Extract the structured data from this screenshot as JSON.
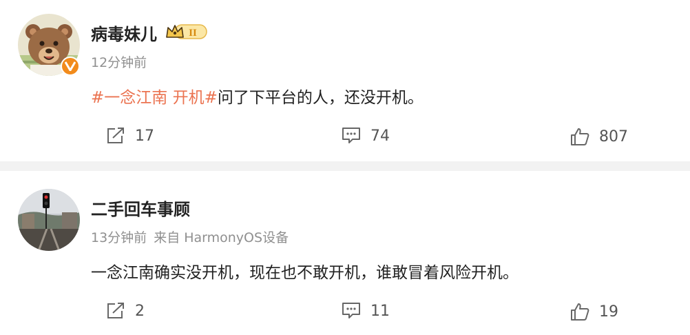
{
  "posts": [
    {
      "user": "病毒妹儿",
      "time": "12分钟前",
      "source": "",
      "topic": "#一念江南 开机#",
      "text": "问了下平台的人，还没开机。",
      "shares": "17",
      "comments": "74",
      "likes": "807",
      "badge_icon": "level-II-crown-badge-icon",
      "verified_icon": "orange-v-verified-icon"
    },
    {
      "user": "二手回车事顾",
      "time": "13分钟前",
      "source": "来自 HarmonyOS设备",
      "text": "一念江南确实没开机，现在也不敢开机，谁敢冒着风险开机。",
      "shares": "2",
      "comments": "11",
      "likes": "19"
    }
  ],
  "colors": {
    "topic": "#eb7350",
    "divider": "#f2f2f2",
    "meta": "#8f8f8f",
    "verified": "#f28b1b"
  },
  "icons": {
    "share": "share-icon",
    "comment": "comment-icon",
    "like": "thumbs-up-icon"
  }
}
